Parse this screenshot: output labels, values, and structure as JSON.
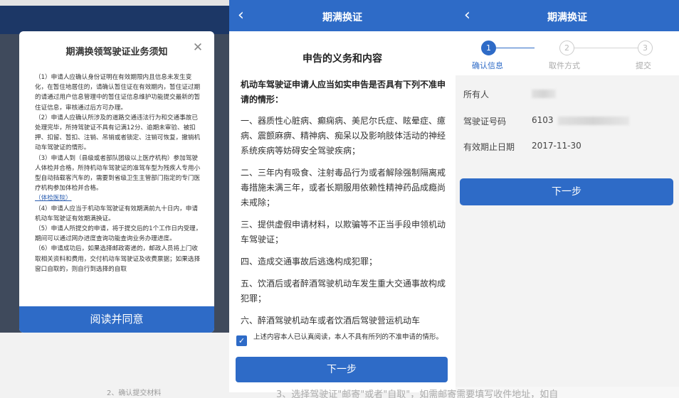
{
  "panel1": {
    "modal": {
      "title": "期满换领驾驶证业务须知",
      "close_glyph": "✕",
      "paragraphs": [
        "（1）申请人应确认身份证明在有效期限内且信息未发生变化，在暂住地居住的，请确认暂住证在有效期内，暂住证过期的请通过用户信息管理中的暂住证信息维护功能提交最新的暂住证信息，审核通过后方可办理。",
        "（2）申请人应确认所涉及的道路交通违法行为和交通事故已处理完毕，所持驾驶证不具有记满12分、逾期未审验、被扣押、扣留、暂扣、注销、吊销或者锁定、注销可恢复，撤销机动车驾驶证的情形。",
        "（3）申请人到（县级或者部队团级以上医疗机构）参加驾驶人体检并合格，所持机动车驾驶证的准驾车型为残疾人专用小型自动挡载客汽车的，需要到省级卫生主管部门指定的专门医疗机构参加体检并合格。"
      ],
      "link_text": "（体检医院）",
      "paragraphs_after": [
        "（4）申请人应当于机动车驾驶证有效期满前九十日内，申请机动车驾驶证有效期满换证。",
        "（5）申请人所提交的申请，将于提交后的1个工作日内受理，期间可以通过网办进度查询功能查询业务办理进度。",
        "（6）申请成功后，如果选择邮政寄递的，邮政人员将上门收取相关资料和费用，交付机动车驾驶证及收费票据；如果选择窗口自取的，则自行到选择的自取"
      ],
      "agree_button": "阅读并同意"
    },
    "bottom_caption": "2、确认提交材料"
  },
  "panel2": {
    "nav": {
      "back_glyph": "‹",
      "title": "期满换证"
    },
    "heading": "申告的义务和内容",
    "intro": "机动车驾驶证申请人应当如实申告是否具有下列不准申请的情形：",
    "items": [
      "一、器质性心脏病、癫痫病、美尼尔氏症、眩晕症、癔病、震颤麻痹、精神病、痴呆以及影响肢体活动的神经系统疾病等妨碍安全驾驶疾病；",
      "二、三年内有吸食、注射毒品行为或者解除强制隔离戒毒措施未满三年，或者长期服用依赖性精神药品成瘾尚未戒除；",
      "三、提供虚假申请材料，以欺骗等不正当手段申领机动车驾驶证；",
      "四、造成交通事故后逃逸构成犯罪；",
      "五、饮酒后或者醉酒驾驶机动车发生重大交通事故构成犯罪；",
      "六、醉酒驾驶机动车或者饮酒后驾驶营运机动车"
    ],
    "checkbox": {
      "checked": true,
      "glyph": "✓",
      "text": "上述内容本人已认真阅读，本人不具有所列的不准申请的情形。"
    },
    "next_button": "下一步"
  },
  "panel3": {
    "nav": {
      "back_glyph": "‹",
      "title": "期满换证"
    },
    "steps": [
      {
        "number": "1",
        "label": "确认信息",
        "active": true
      },
      {
        "number": "2",
        "label": "取件方式",
        "active": false
      },
      {
        "number": "3",
        "label": "提交",
        "active": false
      }
    ],
    "info": [
      {
        "label": "所有人",
        "value": ""
      },
      {
        "label": "驾驶证号码",
        "value": "6103"
      },
      {
        "label": "有效期止日期",
        "value": "2017-11-30"
      }
    ],
    "next_button": "下一步"
  },
  "bottom_caption": "3、选择驾驶证\"邮寄\"或者\"自取\"，如需邮寄需要填写收件地址，如自",
  "colors": {
    "primary": "#2e6bc7",
    "dark_header": "#1c3766",
    "overlay": "#3f4a5c"
  }
}
